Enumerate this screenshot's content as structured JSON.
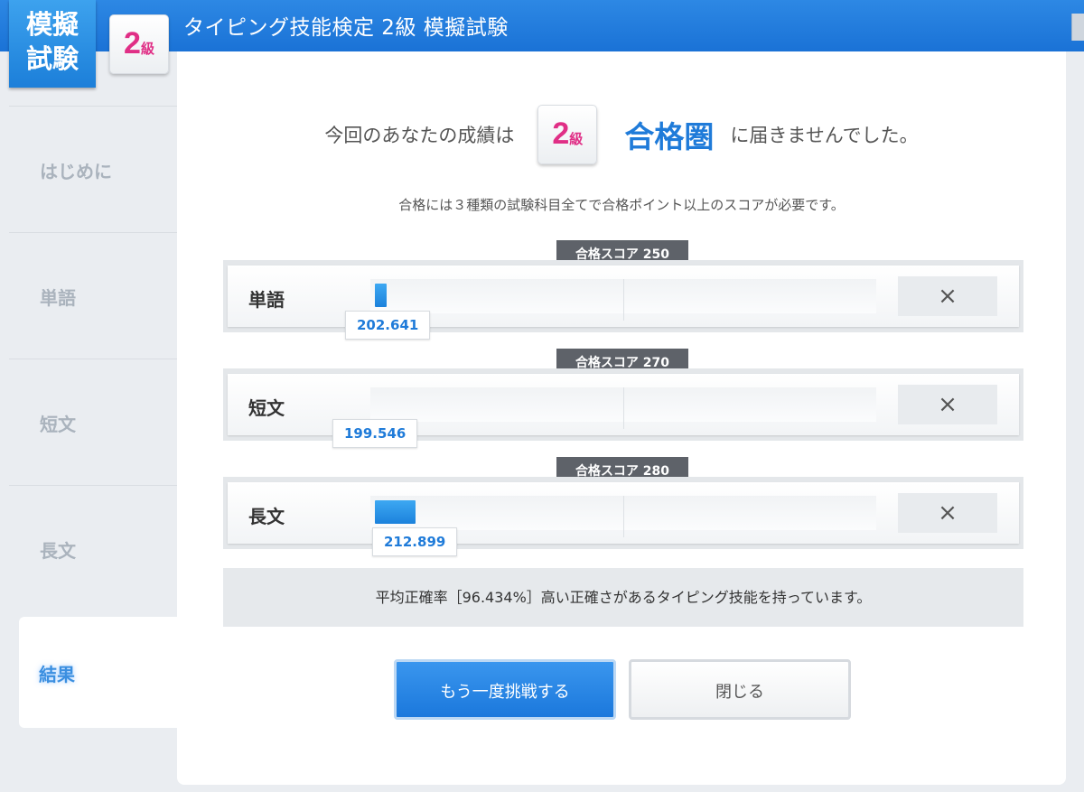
{
  "header": {
    "logo_line1": "模擬",
    "logo_line2": "試験",
    "grade_num": "2",
    "grade_unit": "級",
    "title": "タイピング技能検定 2級 模擬試験"
  },
  "sidebar": {
    "items": [
      {
        "label": "はじめに"
      },
      {
        "label": "単語"
      },
      {
        "label": "短文"
      },
      {
        "label": "長文"
      },
      {
        "label": "結果"
      }
    ],
    "active": "結果"
  },
  "result": {
    "pre_text": "今回のあなたの成績は",
    "grade_num": "2",
    "grade_unit": "級",
    "status": "合格圏",
    "post_text": "に届きませんでした。",
    "note": "合格には３種類の試験科目全てで合格ポイント以上のスコアが必要です。"
  },
  "subjects": [
    {
      "name": "単語",
      "score": "202.641",
      "pass_label": "合格スコア 250",
      "result_mark": "×",
      "fill_fraction": 0.024
    },
    {
      "name": "短文",
      "score": "199.546",
      "pass_label": "合格スコア 270",
      "result_mark": "×",
      "fill_fraction": 0.0
    },
    {
      "name": "長文",
      "score": "212.899",
      "pass_label": "合格スコア 280",
      "result_mark": "×",
      "fill_fraction": 0.08
    }
  ],
  "accuracy_text": "平均正確率［96.434%］高い正確さがあるタイピング技能を持っています。",
  "buttons": {
    "retry": "もう一度挑戦する",
    "close": "閉じる"
  },
  "colors": {
    "accent": "#1f7bd9",
    "grade_pink": "#e02f86",
    "header_blue": "#1a72d6"
  }
}
